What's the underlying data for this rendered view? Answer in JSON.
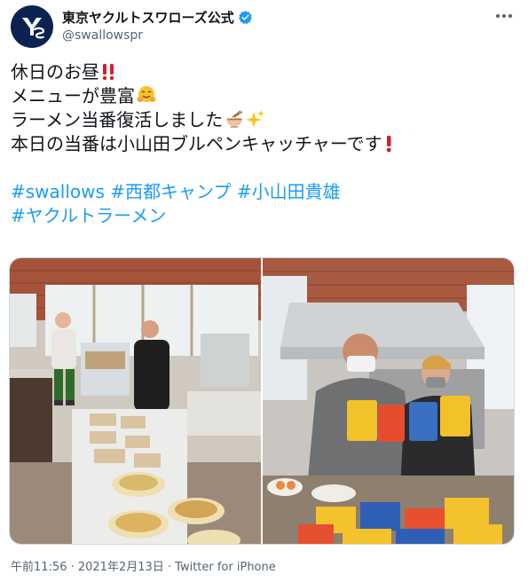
{
  "account": {
    "display_name": "東京ヤクルトスワローズ公式",
    "handle": "@swallowspr",
    "avatar_icon": "swallows-logo-icon",
    "verified_icon": "verified-badge-icon",
    "more_icon": "more-options-icon"
  },
  "tweet": {
    "lines": [
      "休日のお昼",
      "メニューが豊富",
      "ラーメン当番復活しました",
      "本日の当番は小山田ブルペンキャッチャーです"
    ],
    "hashtags_line1": [
      "#swallows",
      "#西都キャンプ",
      "#小山田貴雄"
    ],
    "hashtags_line2": [
      "#ヤクルトラーメン"
    ],
    "emojis": [
      "double-exclamation-icon",
      "hugging-face-icon",
      "ramen-bowl-icon",
      "sparkles-icon",
      "exclamation-icon"
    ]
  },
  "media": {
    "photos": [
      "lunch-buffet-photo",
      "ramen-packages-photo"
    ]
  },
  "footer": {
    "meta": "午前11:56 · 2021年2月13日 · Twitter for iPhone"
  },
  "colors": {
    "text": "#0f1419",
    "secondary": "#536471",
    "link": "#1d9bf0",
    "verified": "#1d9bf0",
    "avatar_bg": "#0b2350"
  }
}
